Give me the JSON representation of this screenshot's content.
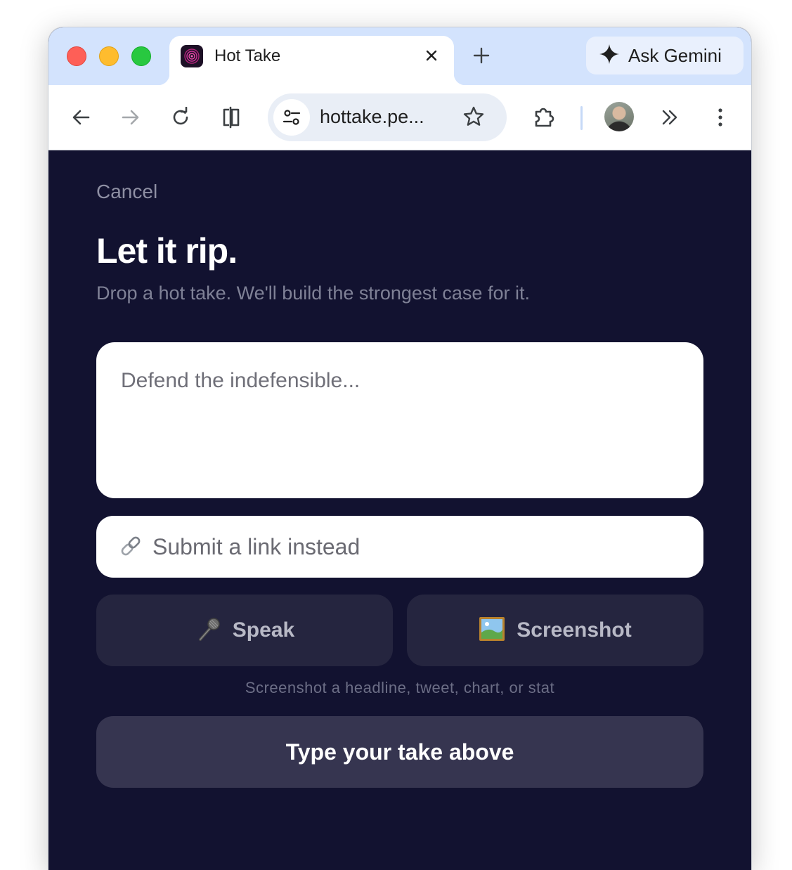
{
  "browser": {
    "tab": {
      "title": "Hot Take",
      "close_icon": "close-icon"
    },
    "new_tab_icon": "plus-icon",
    "gemini": {
      "label": "Ask Gemini",
      "icon": "gemini-sparkle-icon"
    },
    "toolbar": {
      "back_icon": "arrow-left-icon",
      "forward_icon": "arrow-right-icon",
      "reload_icon": "reload-icon",
      "split_view_icon": "split-view-icon",
      "url": "hottake.pe...",
      "site_info_icon": "tune-icon",
      "bookmark_icon": "star-icon",
      "extensions_icon": "puzzle-icon",
      "overflow_icon": "chevron-double-right-icon",
      "menu_icon": "kebab-menu-icon"
    },
    "colors": {
      "tabstrip": "#d3e3fd",
      "traffic_red": "#fe5f57",
      "traffic_yellow": "#febc2e",
      "traffic_green": "#28c840"
    }
  },
  "page": {
    "cancel_label": "Cancel",
    "title": "Let it rip.",
    "subtitle": "Drop a hot take. We'll build the strongest case for it.",
    "take_input": {
      "placeholder": "Defend the indefensible...",
      "value": ""
    },
    "link_input": {
      "placeholder": "Submit a link instead",
      "value": "",
      "icon": "link-icon"
    },
    "speak_button": {
      "label": "Speak",
      "icon": "microphone-icon"
    },
    "screenshot_button": {
      "label": "Screenshot",
      "icon": "framed-picture-icon"
    },
    "hint": "Screenshot a headline, tweet, chart, or stat",
    "submit_button_label": "Type your take above",
    "colors": {
      "background": "#121230",
      "secondary_button": "#25253f",
      "primary_button": "#363550"
    }
  }
}
